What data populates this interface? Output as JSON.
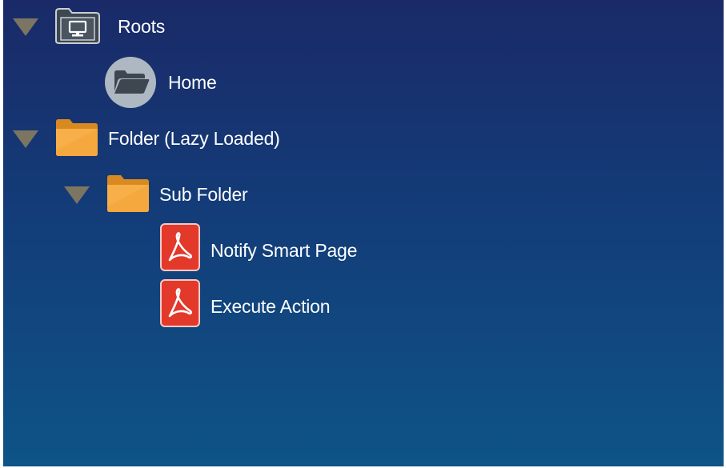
{
  "tree": {
    "nodes": [
      {
        "label": "Roots",
        "icon": "monitor-folder-icon",
        "expanded": true
      },
      {
        "label": "Home",
        "icon": "home-folder-icon"
      },
      {
        "label": "Folder (Lazy Loaded)",
        "icon": "folder-icon",
        "expanded": true
      },
      {
        "label": "Sub Folder",
        "icon": "folder-icon",
        "expanded": true
      },
      {
        "label": "Notify Smart Page",
        "icon": "pdf-icon"
      },
      {
        "label": "Execute Action",
        "icon": "pdf-icon"
      }
    ]
  },
  "colors": {
    "background_top": "#1a2a68",
    "background_bottom": "#0e5486",
    "toggle_arrow": "#7c7562",
    "folder_orange": "#f2a23a",
    "pdf_red": "#e0392b",
    "text": "#ffffff"
  }
}
